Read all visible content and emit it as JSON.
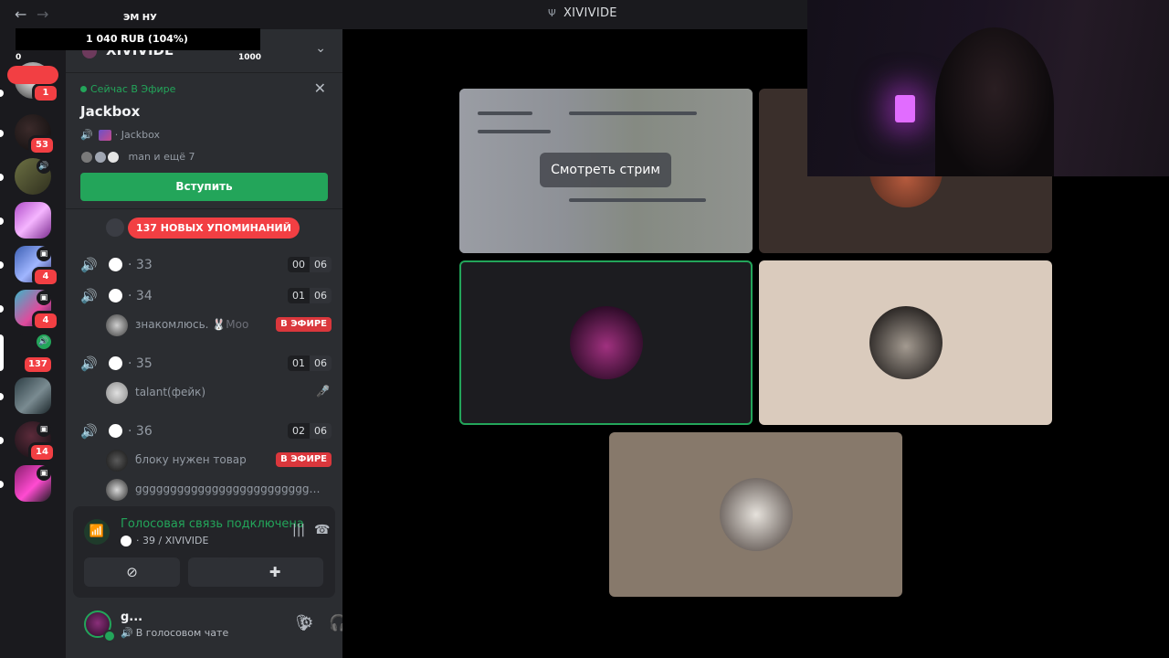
{
  "nav": {
    "back": "←",
    "forward": "→"
  },
  "window": {
    "title": "XIVIVIDE",
    "icon": "Ψ"
  },
  "overlay": {
    "label": "ЭМ НУ",
    "amount": "1 040 RUB (104%)",
    "min": "0",
    "max": "1000"
  },
  "rail": {
    "servers": [
      {
        "badge": "1"
      },
      {
        "badge": "53"
      },
      {
        "mini": "🔊"
      },
      {
        "badge": ""
      },
      {
        "badge": "4",
        "mini": "▣"
      },
      {
        "badge": "4",
        "mini": "▣"
      },
      {
        "badge": "137",
        "mini": "🔊"
      },
      {
        "badge": ""
      },
      {
        "badge": "14",
        "mini": "▣"
      },
      {
        "mini": "▣"
      }
    ]
  },
  "sidebar": {
    "guild_name": "XIVIVIDE",
    "chevron": "⌄",
    "live": {
      "status": "Сейчас В Эфире",
      "close": "✕",
      "title": "Jackbox",
      "activity": "Jackbox",
      "members": "man и ещё 7",
      "join_label": "Вступить"
    },
    "mentions": "137 НОВЫХ УПОМИНАНИЙ",
    "channels": [
      {
        "name": "33",
        "count_a": "00",
        "count_b": "06"
      },
      {
        "name": "34",
        "count_a": "01",
        "count_b": "06"
      },
      {
        "name": "35",
        "count_a": "01",
        "count_b": "06"
      },
      {
        "name": "36",
        "count_a": "02",
        "count_b": "06"
      }
    ],
    "users": {
      "u1": {
        "name": "знакомлюсь.",
        "tag": "🐰Moo",
        "live": "В ЭФИРЕ"
      },
      "u2": {
        "name": "talant(фейк)",
        "mute": "🎤̸"
      },
      "u3": {
        "name": "блоку нужен товар",
        "live": "В ЭФИРЕ"
      },
      "u4": {
        "name": "gggggggggggggggggggggggggggggg..."
      }
    },
    "separator": "·"
  },
  "voice": {
    "title": "Голосовая связь подключена",
    "channel": "39 / XIVIVIDE",
    "icons": {
      "signal": "📶",
      "waves": "|||",
      "hangup": "☎"
    },
    "buttons": {
      "camera": "⊘",
      "share": "⇪",
      "activity": "✚"
    }
  },
  "user": {
    "name": "g...",
    "status": "В голосовом чате",
    "icons": {
      "mic": "🎙",
      "headset": "🎧",
      "settings": "⚙"
    }
  },
  "stage": {
    "watch_label": "Смотреть стрим"
  },
  "colors": {
    "accent_green": "#23a55a",
    "danger_red": "#f23f43",
    "tile_beige": "#dacbbd",
    "tile_brown": "#87796b",
    "tile_dark": "#3a2f2b"
  }
}
